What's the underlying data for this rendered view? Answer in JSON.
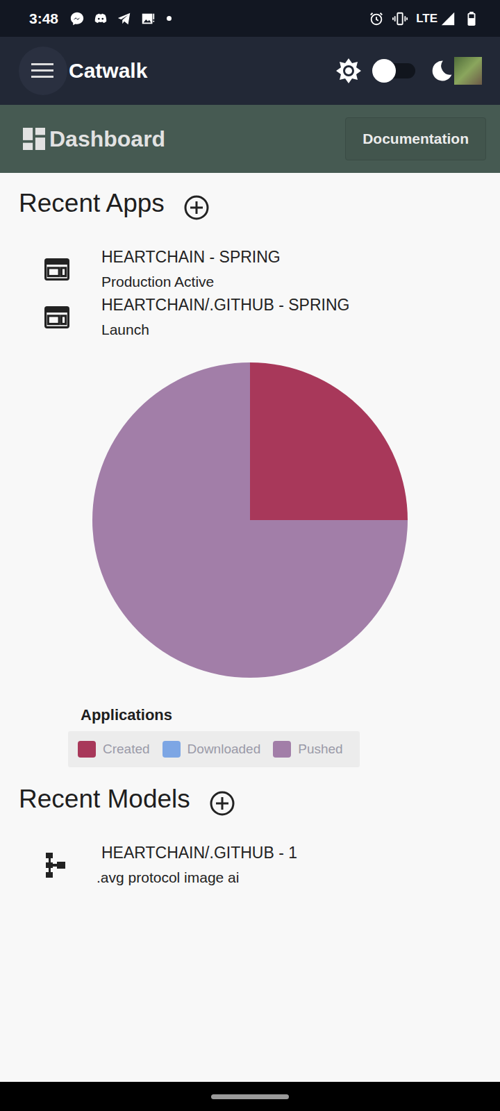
{
  "status_bar": {
    "time": "3:48",
    "network": "LTE"
  },
  "app_bar": {
    "title": "Catwalk",
    "dark_mode": false
  },
  "header": {
    "title": "Dashboard",
    "button": "Documentation"
  },
  "recent_apps": {
    "title": "Recent Apps",
    "items": [
      {
        "name": "HEARTCHAIN - SPRING",
        "status": "Production Active"
      },
      {
        "name": "HEARTCHAIN/.GITHUB - SPRING",
        "status": "Launch"
      }
    ]
  },
  "chart": {
    "title": "Applications",
    "series": [
      {
        "label": "Created",
        "values": [
          1
        ],
        "color": "#a8385a"
      },
      {
        "label": "Downloaded",
        "values": [
          0
        ],
        "color": "#7da6e4"
      },
      {
        "label": "Pushed",
        "values": [
          3
        ],
        "color": "#a27ea8"
      }
    ]
  },
  "recent_models": {
    "title": "Recent Models",
    "items": [
      {
        "name": "HEARTCHAIN/.GITHUB - 1",
        "description": ".avg protocol image ai"
      }
    ]
  }
}
